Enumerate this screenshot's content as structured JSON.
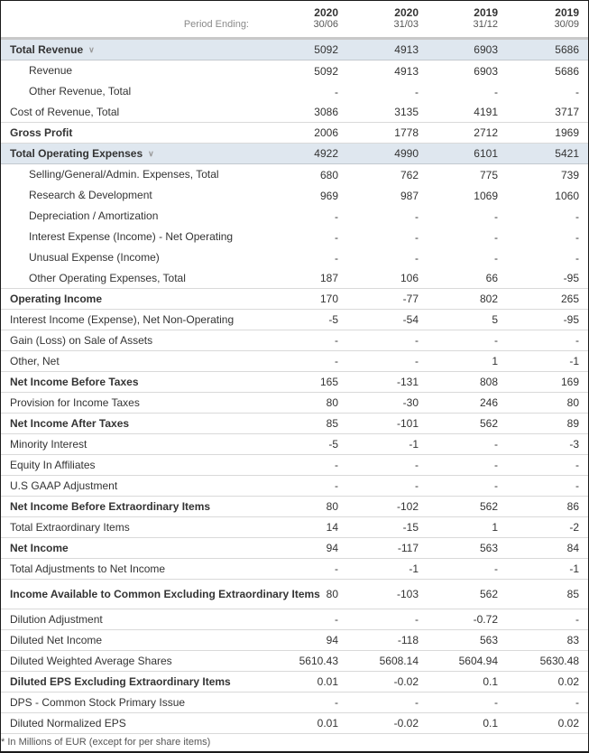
{
  "header": {
    "period_label": "Period Ending:",
    "columns": [
      {
        "year": "2020",
        "date": "30/06"
      },
      {
        "year": "2020",
        "date": "31/03"
      },
      {
        "year": "2019",
        "date": "31/12"
      },
      {
        "year": "2019",
        "date": "30/09"
      }
    ]
  },
  "rows": [
    {
      "label": "Total Revenue",
      "type": "group",
      "values": [
        "5092",
        "4913",
        "6903",
        "5686"
      ]
    },
    {
      "label": "Revenue",
      "type": "child",
      "values": [
        "5092",
        "4913",
        "6903",
        "5686"
      ]
    },
    {
      "label": "Other Revenue, Total",
      "type": "child",
      "values": [
        "-",
        "-",
        "-",
        "-"
      ]
    },
    {
      "label": "Cost of Revenue, Total",
      "type": "normal",
      "values": [
        "3086",
        "3135",
        "4191",
        "3717"
      ]
    },
    {
      "label": "Gross Profit",
      "type": "bold",
      "values": [
        "2006",
        "1778",
        "2712",
        "1969"
      ]
    },
    {
      "label": "Total Operating Expenses",
      "type": "group",
      "values": [
        "4922",
        "4990",
        "6101",
        "5421"
      ]
    },
    {
      "label": "Selling/General/Admin. Expenses, Total",
      "type": "child",
      "values": [
        "680",
        "762",
        "775",
        "739"
      ]
    },
    {
      "label": "Research & Development",
      "type": "child",
      "values": [
        "969",
        "987",
        "1069",
        "1060"
      ]
    },
    {
      "label": "Depreciation / Amortization",
      "type": "child",
      "values": [
        "-",
        "-",
        "-",
        "-"
      ]
    },
    {
      "label": "Interest Expense (Income) - Net Operating",
      "type": "child",
      "values": [
        "-",
        "-",
        "-",
        "-"
      ]
    },
    {
      "label": "Unusual Expense (Income)",
      "type": "child",
      "values": [
        "-",
        "-",
        "-",
        "-"
      ]
    },
    {
      "label": "Other Operating Expenses, Total",
      "type": "child-last",
      "values": [
        "187",
        "106",
        "66",
        "-95"
      ]
    },
    {
      "label": "Operating Income",
      "type": "bold",
      "values": [
        "170",
        "-77",
        "802",
        "265"
      ]
    },
    {
      "label": "Interest Income (Expense), Net Non-Operating",
      "type": "normal",
      "values": [
        "-5",
        "-54",
        "5",
        "-95"
      ]
    },
    {
      "label": "Gain (Loss) on Sale of Assets",
      "type": "normal",
      "values": [
        "-",
        "-",
        "-",
        "-"
      ]
    },
    {
      "label": "Other, Net",
      "type": "normal",
      "values": [
        "-",
        "-",
        "1",
        "-1"
      ]
    },
    {
      "label": "Net Income Before Taxes",
      "type": "bold",
      "values": [
        "165",
        "-131",
        "808",
        "169"
      ]
    },
    {
      "label": "Provision for Income Taxes",
      "type": "normal",
      "values": [
        "80",
        "-30",
        "246",
        "80"
      ]
    },
    {
      "label": "Net Income After Taxes",
      "type": "bold",
      "values": [
        "85",
        "-101",
        "562",
        "89"
      ]
    },
    {
      "label": "Minority Interest",
      "type": "normal",
      "values": [
        "-5",
        "-1",
        "-",
        "-3"
      ]
    },
    {
      "label": "Equity In Affiliates",
      "type": "normal",
      "values": [
        "-",
        "-",
        "-",
        "-"
      ]
    },
    {
      "label": "U.S GAAP Adjustment",
      "type": "normal",
      "values": [
        "-",
        "-",
        "-",
        "-"
      ]
    },
    {
      "label": "Net Income Before Extraordinary Items",
      "type": "bold",
      "values": [
        "80",
        "-102",
        "562",
        "86"
      ]
    },
    {
      "label": "Total Extraordinary Items",
      "type": "normal",
      "values": [
        "14",
        "-15",
        "1",
        "-2"
      ]
    },
    {
      "label": "Net Income",
      "type": "bold",
      "values": [
        "94",
        "-117",
        "563",
        "84"
      ]
    },
    {
      "label": "Total Adjustments to Net Income",
      "type": "normal",
      "values": [
        "-",
        "-1",
        "-",
        "-1"
      ]
    },
    {
      "label": "Income Available to Common Excluding Extraordinary Items",
      "type": "bold-tall",
      "values": [
        "80",
        "-103",
        "562",
        "85"
      ]
    },
    {
      "label": "Dilution Adjustment",
      "type": "normal",
      "values": [
        "-",
        "-",
        "-0.72",
        "-"
      ]
    },
    {
      "label": "Diluted Net Income",
      "type": "normal",
      "values": [
        "94",
        "-118",
        "563",
        "83"
      ]
    },
    {
      "label": "Diluted Weighted Average Shares",
      "type": "normal",
      "values": [
        "5610.43",
        "5608.14",
        "5604.94",
        "5630.48"
      ]
    },
    {
      "label": "Diluted EPS Excluding Extraordinary Items",
      "type": "bold",
      "values": [
        "0.01",
        "-0.02",
        "0.1",
        "0.02"
      ]
    },
    {
      "label": "DPS - Common Stock Primary Issue",
      "type": "normal",
      "values": [
        "-",
        "-",
        "-",
        "-"
      ]
    },
    {
      "label": "Diluted Normalized EPS",
      "type": "normal",
      "values": [
        "0.01",
        "-0.02",
        "0.1",
        "0.02"
      ]
    }
  ],
  "footnote": "* In Millions of EUR (except for per share items)",
  "icons": {
    "expand": "chevron-down-icon"
  }
}
